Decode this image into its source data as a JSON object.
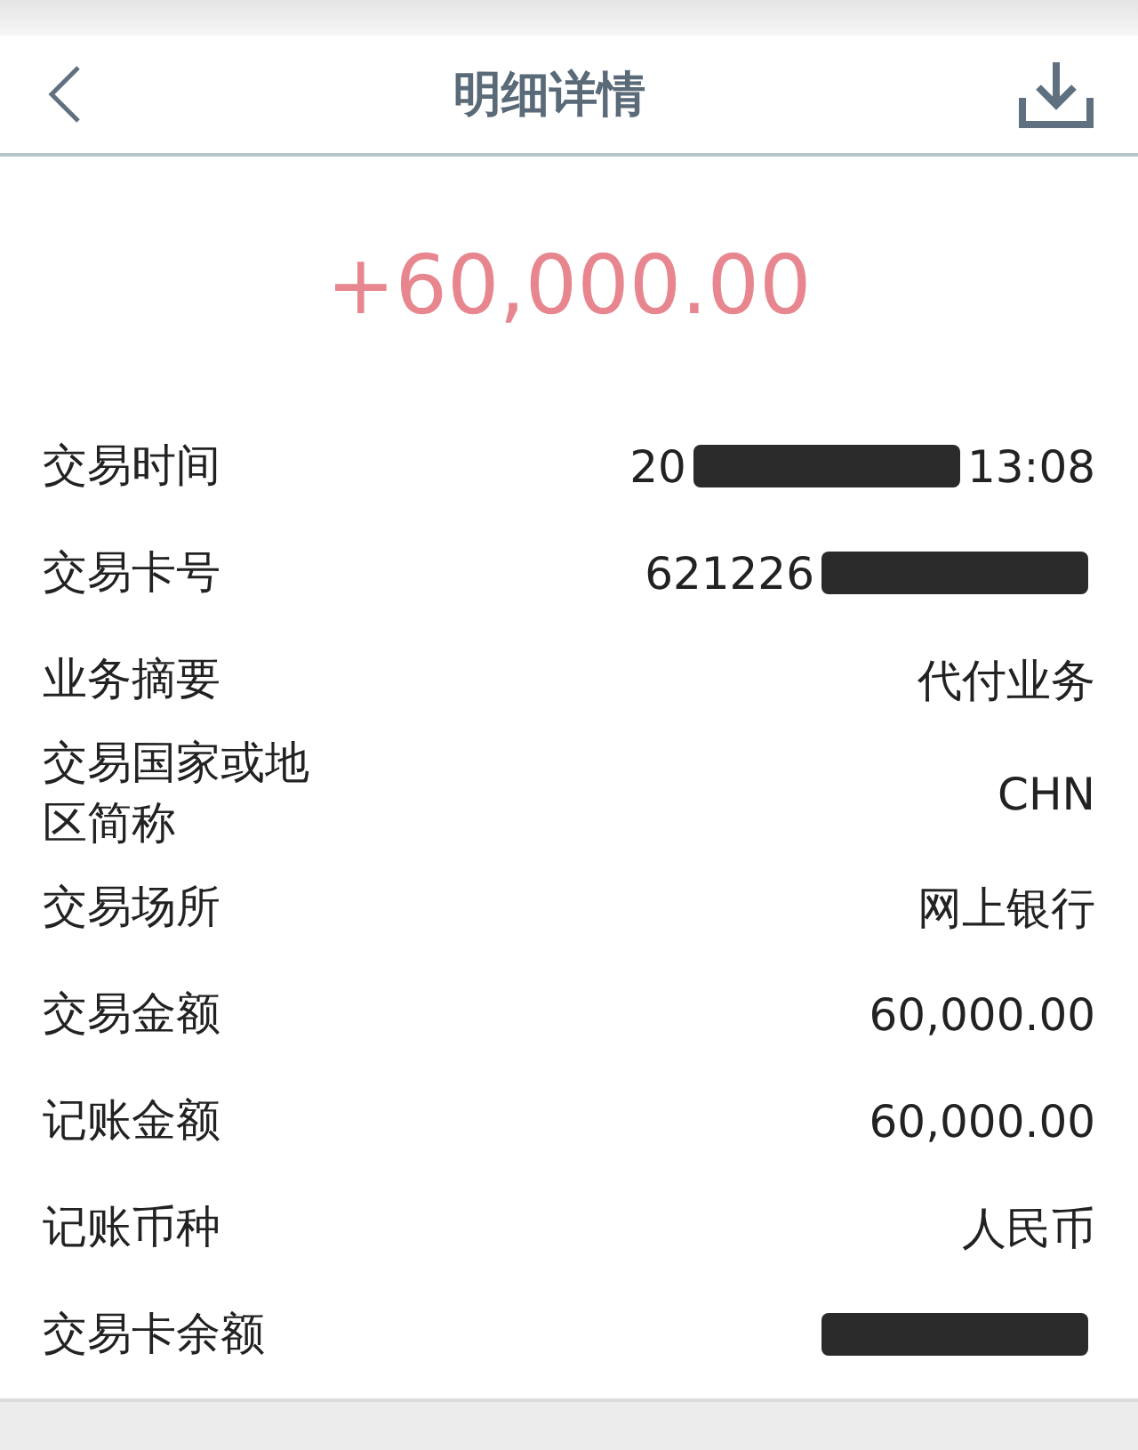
{
  "header": {
    "title": "明细详情"
  },
  "amount": "+60,000.00",
  "rows": [
    {
      "label": "交易时间",
      "value": [
        {
          "kind": "text",
          "text": "20"
        },
        {
          "kind": "redacted"
        },
        {
          "kind": "text",
          "text": "13:08"
        }
      ]
    },
    {
      "label": "交易卡号",
      "value": [
        {
          "kind": "text",
          "text": "621226"
        },
        {
          "kind": "redacted"
        }
      ]
    },
    {
      "label": "业务摘要",
      "value": [
        {
          "kind": "text",
          "text": "代付业务"
        }
      ]
    },
    {
      "label": "交易国家或地区简称",
      "value": [
        {
          "kind": "text",
          "text": "CHN"
        }
      ]
    },
    {
      "label": "交易场所",
      "value": [
        {
          "kind": "text",
          "text": "网上银行"
        }
      ]
    },
    {
      "label": "交易金额",
      "value": [
        {
          "kind": "text",
          "text": "60,000.00"
        }
      ]
    },
    {
      "label": "记账金额",
      "value": [
        {
          "kind": "text",
          "text": "60,000.00"
        }
      ]
    },
    {
      "label": "记账币种",
      "value": [
        {
          "kind": "text",
          "text": "人民币"
        }
      ]
    },
    {
      "label": "交易卡余额",
      "value": [
        {
          "kind": "redacted"
        }
      ]
    }
  ]
}
